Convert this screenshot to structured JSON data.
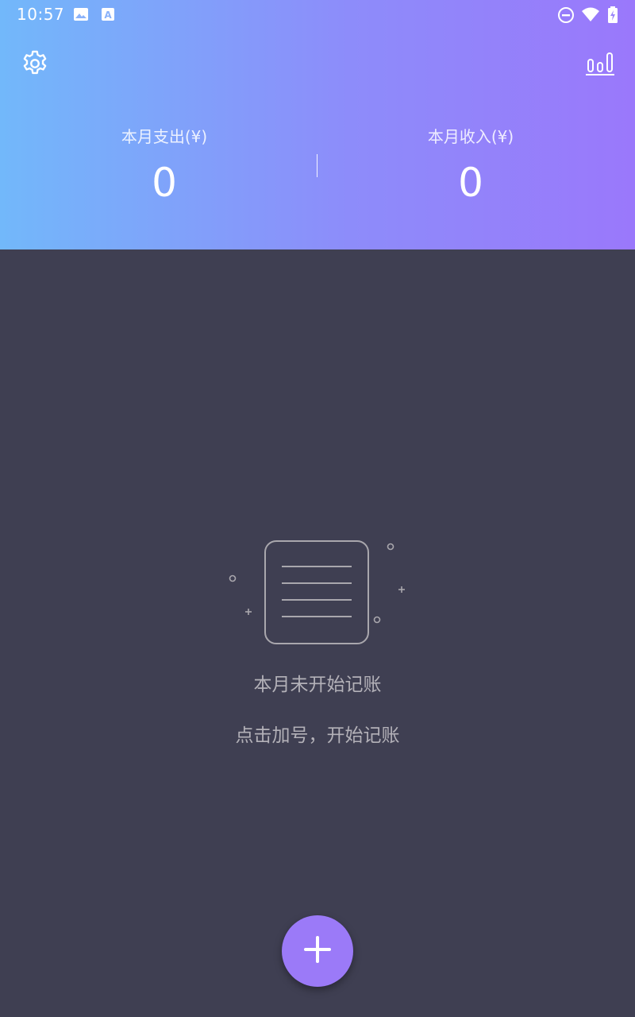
{
  "status_bar": {
    "time": "10:57",
    "left_icons": [
      "image-icon",
      "font-a-icon"
    ],
    "right_icons": [
      "do-not-disturb-icon",
      "wifi-icon",
      "battery-charging-icon"
    ]
  },
  "header": {
    "gradient_colors": [
      "#72b8fa",
      "#9a78fb"
    ],
    "settings_icon": "gear-icon",
    "stats_icon": "bar-chart-icon",
    "expense": {
      "label": "本月支出(¥)",
      "value": "0"
    },
    "income": {
      "label": "本月收入(¥)",
      "value": "0"
    }
  },
  "empty_state": {
    "icon": "empty-notebook-icon",
    "title": "本月未开始记账",
    "hint": "点击加号，开始记账"
  },
  "fab": {
    "icon": "plus-icon",
    "color": "#9b7af8"
  },
  "colors": {
    "background": "#3f3f52",
    "muted_text": "#b3b1b8"
  }
}
